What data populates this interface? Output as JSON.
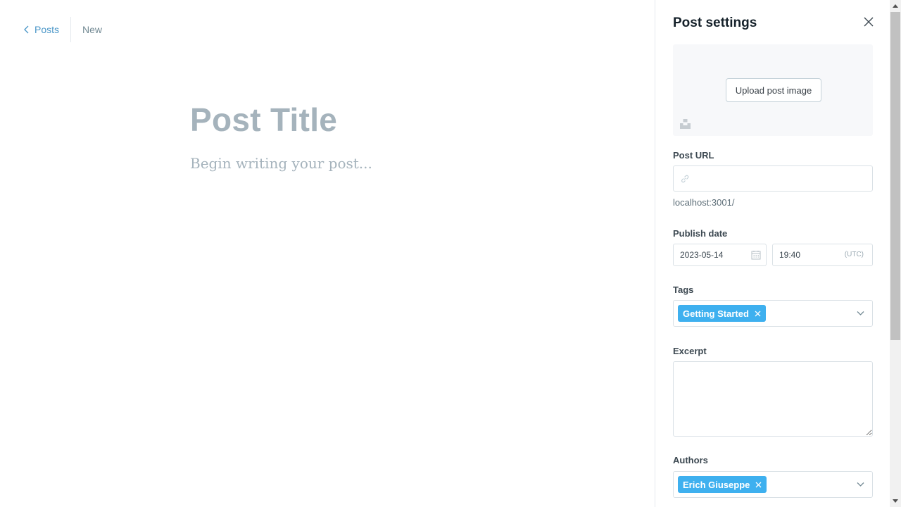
{
  "breadcrumb": {
    "back_label": "Posts",
    "status": "New"
  },
  "editor": {
    "title_placeholder": "Post Title",
    "body_placeholder": "Begin writing your post..."
  },
  "settings": {
    "title": "Post settings",
    "upload_label": "Upload post image",
    "post_url": {
      "label": "Post URL",
      "value": "",
      "hint": "localhost:3001/"
    },
    "publish_date": {
      "label": "Publish date",
      "date": "2023-05-14",
      "time": "19:40",
      "timezone": "(UTC)"
    },
    "tags": {
      "label": "Tags",
      "items": [
        "Getting Started"
      ]
    },
    "excerpt": {
      "label": "Excerpt",
      "value": ""
    },
    "authors": {
      "label": "Authors",
      "items": [
        "Erich Giuseppe"
      ]
    }
  },
  "colors": {
    "accent": "#3eb0ef",
    "link": "#4b97c8",
    "placeholder": "#a5b3bc"
  }
}
